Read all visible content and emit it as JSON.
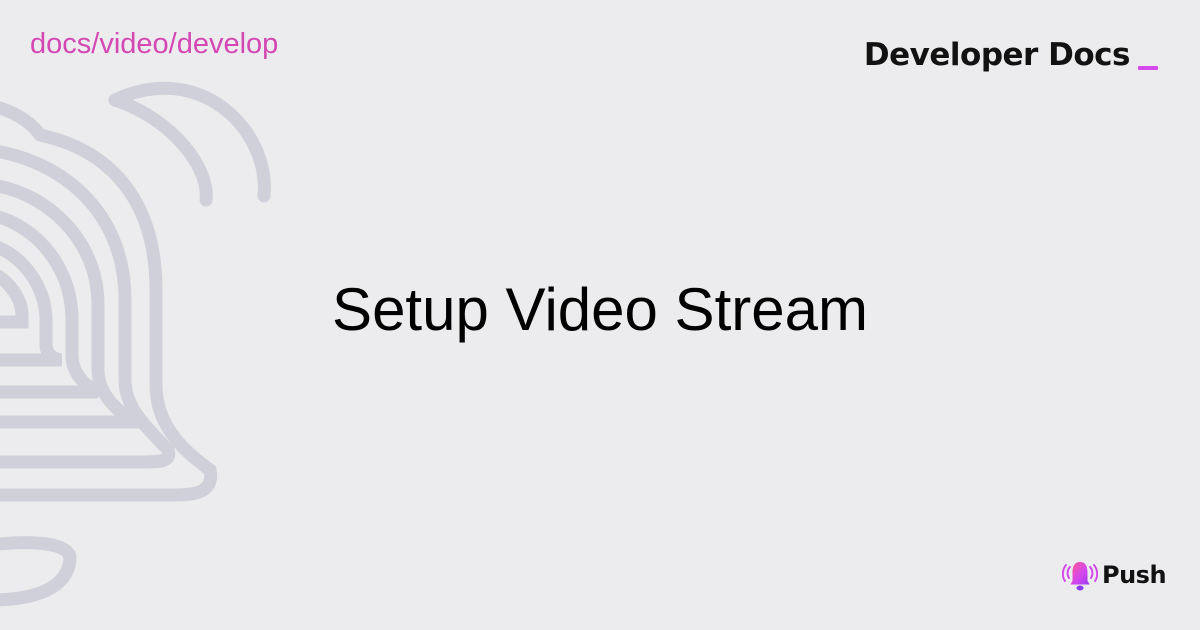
{
  "header": {
    "path_label": "docs/video/develop",
    "brand_title": "Developer Docs"
  },
  "main": {
    "title": "Setup Video Stream"
  },
  "logo": {
    "text": "Push"
  },
  "colors": {
    "background": "#ececee",
    "accent": "#d548ec",
    "path_text": "#d448b4",
    "text_dark": "#121212",
    "outline_art": "#d0d0da"
  },
  "icons": {
    "background_art": "bell-outline-icon",
    "logo_icon": "ringing-bell-icon"
  }
}
